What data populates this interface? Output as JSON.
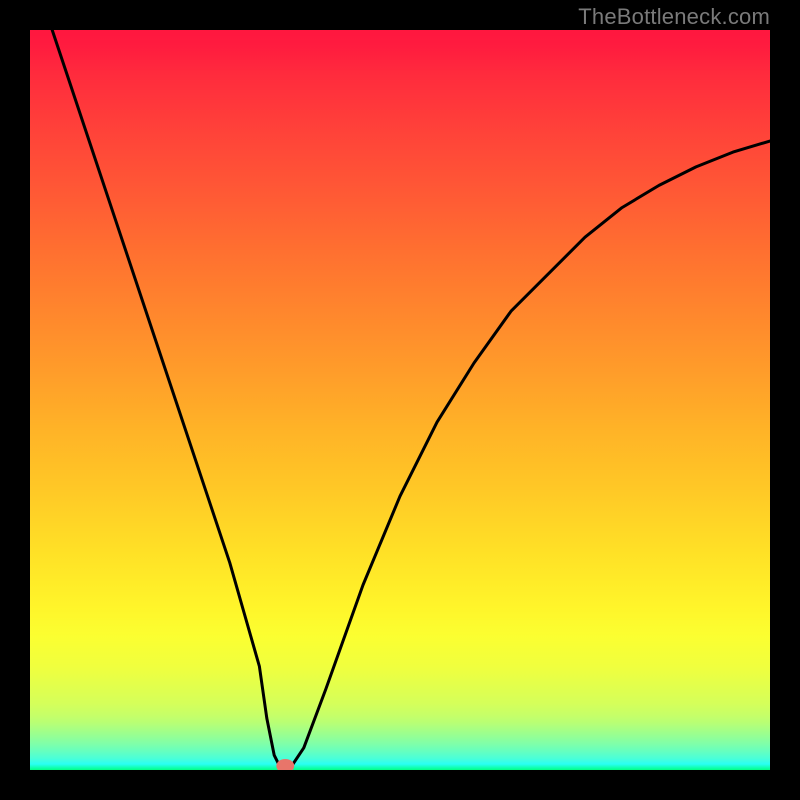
{
  "watermark": "TheBottleneck.com",
  "chart_data": {
    "type": "line",
    "title": "",
    "xlabel": "",
    "ylabel": "",
    "xlim": [
      0,
      100
    ],
    "ylim": [
      0,
      100
    ],
    "grid": false,
    "legend": false,
    "series": [
      {
        "name": "bottleneck-curve",
        "color": "#000000",
        "x": [
          3,
          5,
          8,
          12,
          16,
          20,
          24,
          27,
          29,
          31,
          32,
          33,
          34,
          35,
          37,
          40,
          45,
          50,
          55,
          60,
          65,
          70,
          75,
          80,
          85,
          90,
          95,
          100
        ],
        "values": [
          100,
          94,
          85,
          73,
          61,
          49,
          37,
          28,
          21,
          14,
          7,
          2,
          0,
          0,
          3,
          11,
          25,
          37,
          47,
          55,
          62,
          67,
          72,
          76,
          79,
          81.5,
          83.5,
          85
        ]
      }
    ],
    "marker": {
      "name": "optimal-point",
      "x": 34.5,
      "y": 0,
      "color": "#e8756a"
    }
  }
}
